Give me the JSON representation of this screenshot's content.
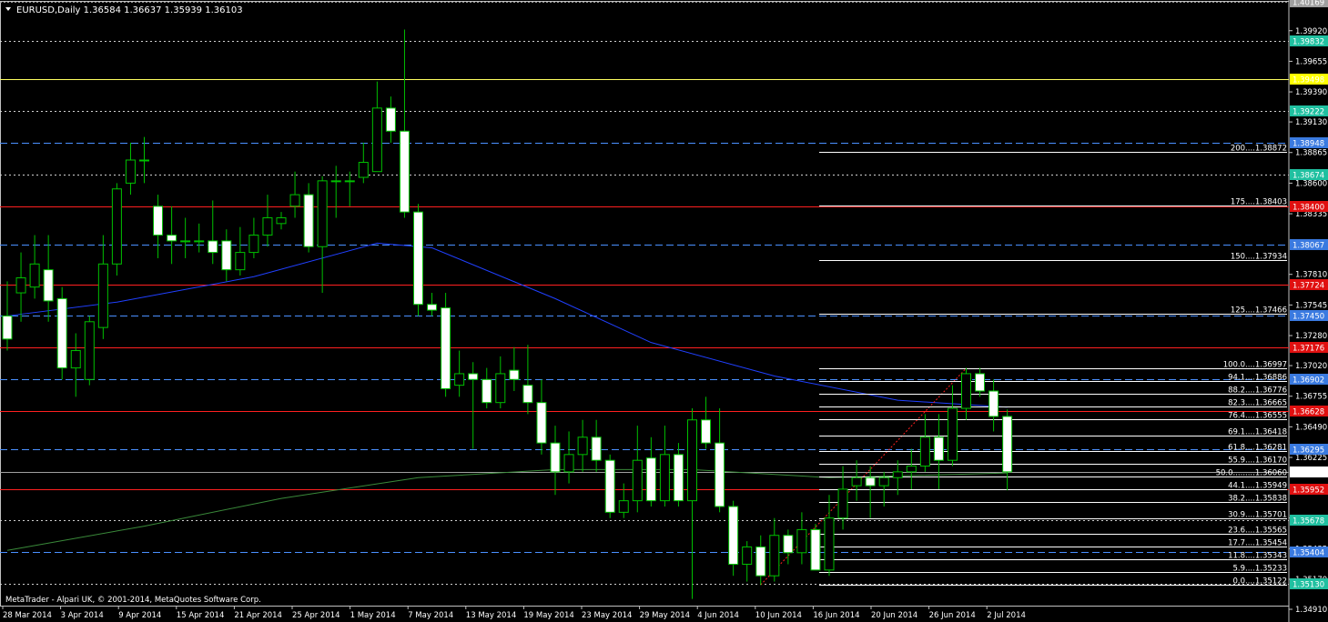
{
  "window": {
    "symbol_line": "EURUSD,Daily  1.36584 1.36637 1.35939 1.36103",
    "copyright": "MetaTrader - Alpari UK, © 2001-2014, MetaQuotes Software Corp."
  },
  "colors": {
    "background": "#000000",
    "bull": "#00c000",
    "bear": "#ffffff",
    "ma_fast": "#2040ff",
    "ma_slow": "#3a8a3a",
    "support": "#ff2020",
    "blue_level": "#4a90ff",
    "fib_line": "#ffffff",
    "fib_diag": "#ff2020",
    "current_price": "#a0a0a0"
  },
  "chart_data": {
    "type": "candlestick",
    "instrument": "EURUSD",
    "timeframe": "Daily",
    "ylim": [
      1.3491,
      1.4017
    ],
    "y_ticks": [
      "1.39920",
      "1.39655",
      "1.39390",
      "1.39130",
      "1.38865",
      "1.38600",
      "1.38335",
      "1.37810",
      "1.37545",
      "1.37280",
      "1.37020",
      "1.36755",
      "1.36490",
      "1.36225",
      "1.35700",
      "1.35435",
      "1.35170",
      "1.34910"
    ],
    "x_labels": [
      "28 Mar 2014",
      "3 Apr 2014",
      "9 Apr 2014",
      "15 Apr 2014",
      "21 Apr 2014",
      "25 Apr 2014",
      "1 May 2014",
      "7 May 2014",
      "13 May 2014",
      "19 May 2014",
      "23 May 2014",
      "29 May 2014",
      "4 Jun 2014",
      "10 Jun 2014",
      "16 Jun 2014",
      "20 Jun 2014",
      "26 Jun 2014",
      "2 Jul 2014"
    ],
    "price_labels": [
      {
        "text": "1.40169",
        "value": 1.40169,
        "kind": "grey"
      },
      {
        "text": "1.39832",
        "value": 1.39832,
        "kind": "teal"
      },
      {
        "text": "1.39498",
        "value": 1.39498,
        "kind": "yellow"
      },
      {
        "text": "1.39222",
        "value": 1.39222,
        "kind": "teal"
      },
      {
        "text": "1.38948",
        "value": 1.38948,
        "kind": "blue"
      },
      {
        "text": "1.38674",
        "value": 1.38674,
        "kind": "teal"
      },
      {
        "text": "1.38400",
        "value": 1.384,
        "kind": "red"
      },
      {
        "text": "1.38067",
        "value": 1.38067,
        "kind": "blue"
      },
      {
        "text": "1.37724",
        "value": 1.37724,
        "kind": "red"
      },
      {
        "text": "1.37450",
        "value": 1.3745,
        "kind": "blue"
      },
      {
        "text": "1.37176",
        "value": 1.37176,
        "kind": "red"
      },
      {
        "text": "1.36902",
        "value": 1.36902,
        "kind": "blue"
      },
      {
        "text": "1.36628",
        "value": 1.36628,
        "kind": "red"
      },
      {
        "text": "1.36295",
        "value": 1.36295,
        "kind": "blue"
      },
      {
        "text": "1.36103",
        "value": 1.36103,
        "kind": "current"
      },
      {
        "text": "1.35952",
        "value": 1.35952,
        "kind": "red"
      },
      {
        "text": "1.35678",
        "value": 1.35678,
        "kind": "teal"
      },
      {
        "text": "1.35404",
        "value": 1.35404,
        "kind": "blue"
      },
      {
        "text": "1.35130",
        "value": 1.3513,
        "kind": "teal"
      }
    ],
    "horizontal_levels": [
      {
        "value": 1.40169,
        "style": "dot-grey"
      },
      {
        "value": 1.39832,
        "style": "dot-white"
      },
      {
        "value": 1.39498,
        "style": "solid-yellow"
      },
      {
        "value": 1.39222,
        "style": "dot-white"
      },
      {
        "value": 1.38948,
        "style": "dash-blue"
      },
      {
        "value": 1.38674,
        "style": "dot-white"
      },
      {
        "value": 1.384,
        "style": "solid-red"
      },
      {
        "value": 1.38067,
        "style": "dash-blue"
      },
      {
        "value": 1.37724,
        "style": "solid-red"
      },
      {
        "value": 1.3745,
        "style": "dash-blue"
      },
      {
        "value": 1.37176,
        "style": "solid-red"
      },
      {
        "value": 1.36902,
        "style": "dash-blue"
      },
      {
        "value": 1.36628,
        "style": "solid-red"
      },
      {
        "value": 1.36295,
        "style": "dash-blue"
      },
      {
        "value": 1.36103,
        "style": "solid-grey"
      },
      {
        "value": 1.35952,
        "style": "solid-red"
      },
      {
        "value": 1.35678,
        "style": "dot-white"
      },
      {
        "value": 1.35404,
        "style": "dash-blue"
      },
      {
        "value": 1.3513,
        "style": "dot-white"
      }
    ],
    "fib_levels": [
      {
        "label": "200....1.38872",
        "value": 1.38872
      },
      {
        "label": "175....1.38403",
        "value": 1.38403
      },
      {
        "label": "150....1.37934",
        "value": 1.37934
      },
      {
        "label": "125....1.37466",
        "value": 1.37466
      },
      {
        "label": "100.0....1.36997",
        "value": 1.36997
      },
      {
        "label": "94.1....1.36886",
        "value": 1.36886
      },
      {
        "label": "88.2....1.36776",
        "value": 1.36776
      },
      {
        "label": "82.3....1.36665",
        "value": 1.36665
      },
      {
        "label": "76.4....1.36555",
        "value": 1.36555
      },
      {
        "label": "69.1....1.36418",
        "value": 1.36418
      },
      {
        "label": "61.8....1.36281",
        "value": 1.36281
      },
      {
        "label": "55.9....1.36170",
        "value": 1.3617
      },
      {
        "label": "50.0.........1.36060",
        "value": 1.3606
      },
      {
        "label": "44.1....1.35949",
        "value": 1.35949
      },
      {
        "label": "38.2....1.35838",
        "value": 1.35838
      },
      {
        "label": "30.9....1.35701",
        "value": 1.35701
      },
      {
        "label": "23.6....1.35565",
        "value": 1.35565
      },
      {
        "label": "17.7....1.35454",
        "value": 1.35454
      },
      {
        "label": "11.8....1.35343",
        "value": 1.35343
      },
      {
        "label": "5.9....1.35233",
        "value": 1.35233
      },
      {
        "label": "0.0....1.35122",
        "value": 1.35122
      }
    ],
    "candles": [
      [
        1.3745,
        1.3725,
        1.3775,
        1.3715
      ],
      [
        1.3765,
        1.3778,
        1.38,
        1.374
      ],
      [
        1.377,
        1.379,
        1.3815,
        1.376
      ],
      [
        1.3785,
        1.3758,
        1.3815,
        1.374
      ],
      [
        1.376,
        1.37,
        1.377,
        1.369
      ],
      [
        1.37,
        1.3715,
        1.373,
        1.3675
      ],
      [
        1.369,
        1.374,
        1.3745,
        1.3685
      ],
      [
        1.3735,
        1.379,
        1.3815,
        1.3725
      ],
      [
        1.379,
        1.3855,
        1.386,
        1.378
      ],
      [
        1.386,
        1.388,
        1.3895,
        1.385
      ],
      [
        1.388,
        1.388,
        1.39,
        1.386
      ],
      [
        1.384,
        1.3815,
        1.385,
        1.3795
      ],
      [
        1.3815,
        1.381,
        1.384,
        1.379
      ],
      [
        1.381,
        1.381,
        1.383,
        1.3795
      ],
      [
        1.381,
        1.381,
        1.3825,
        1.38
      ],
      [
        1.381,
        1.38,
        1.3845,
        1.379
      ],
      [
        1.381,
        1.3785,
        1.382,
        1.3775
      ],
      [
        1.3785,
        1.38,
        1.3822,
        1.378
      ],
      [
        1.38,
        1.3815,
        1.383,
        1.3795
      ],
      [
        1.3815,
        1.383,
        1.385,
        1.3805
      ],
      [
        1.3825,
        1.383,
        1.3835,
        1.382
      ],
      [
        1.384,
        1.385,
        1.387,
        1.383
      ],
      [
        1.385,
        1.3805,
        1.386,
        1.38
      ],
      [
        1.3805,
        1.3862,
        1.3866,
        1.3765
      ],
      [
        1.3862,
        1.3862,
        1.3875,
        1.383
      ],
      [
        1.3862,
        1.3862,
        1.387,
        1.384
      ],
      [
        1.3865,
        1.3878,
        1.3895,
        1.386
      ],
      [
        1.387,
        1.3925,
        1.3948,
        1.387
      ],
      [
        1.3925,
        1.3905,
        1.3935,
        1.3895
      ],
      [
        1.3905,
        1.3835,
        1.3993,
        1.383
      ],
      [
        1.3835,
        1.3755,
        1.3842,
        1.3745
      ],
      [
        1.3755,
        1.375,
        1.3765,
        1.3745
      ],
      [
        1.3752,
        1.3682,
        1.3765,
        1.3675
      ],
      [
        1.3685,
        1.3695,
        1.3715,
        1.3675
      ],
      [
        1.3695,
        1.369,
        1.3705,
        1.363
      ],
      [
        1.369,
        1.367,
        1.37,
        1.3665
      ],
      [
        1.367,
        1.3695,
        1.371,
        1.3665
      ],
      [
        1.3698,
        1.369,
        1.3718,
        1.368
      ],
      [
        1.3685,
        1.367,
        1.372,
        1.366
      ],
      [
        1.367,
        1.3635,
        1.369,
        1.3625
      ],
      [
        1.3635,
        1.361,
        1.365,
        1.359
      ],
      [
        1.361,
        1.3625,
        1.3645,
        1.36
      ],
      [
        1.3625,
        1.364,
        1.3655,
        1.361
      ],
      [
        1.364,
        1.362,
        1.3655,
        1.361
      ],
      [
        1.362,
        1.3575,
        1.3625,
        1.357
      ],
      [
        1.3575,
        1.3585,
        1.36,
        1.357
      ],
      [
        1.3585,
        1.362,
        1.365,
        1.3575
      ],
      [
        1.3622,
        1.3585,
        1.364,
        1.358
      ],
      [
        1.3585,
        1.3625,
        1.365,
        1.358
      ],
      [
        1.3625,
        1.3585,
        1.3635,
        1.358
      ],
      [
        1.3585,
        1.3655,
        1.3665,
        1.35
      ],
      [
        1.3655,
        1.3635,
        1.3675,
        1.363
      ],
      [
        1.3635,
        1.358,
        1.3665,
        1.3575
      ],
      [
        1.358,
        1.353,
        1.3585,
        1.352
      ],
      [
        1.353,
        1.3545,
        1.355,
        1.3515
      ],
      [
        1.3545,
        1.352,
        1.3555,
        1.3512
      ],
      [
        1.352,
        1.3555,
        1.357,
        1.3515
      ],
      [
        1.3555,
        1.354,
        1.356,
        1.353
      ],
      [
        1.354,
        1.356,
        1.3575,
        1.353
      ],
      [
        1.356,
        1.3525,
        1.3565,
        1.3525
      ],
      [
        1.3525,
        1.357,
        1.359,
        1.352
      ],
      [
        1.357,
        1.3595,
        1.3615,
        1.356
      ],
      [
        1.3598,
        1.3605,
        1.362,
        1.3585
      ],
      [
        1.3605,
        1.3598,
        1.3615,
        1.357
      ],
      [
        1.3598,
        1.3605,
        1.361,
        1.358
      ],
      [
        1.3605,
        1.361,
        1.362,
        1.359
      ],
      [
        1.361,
        1.3615,
        1.363,
        1.3595
      ],
      [
        1.3615,
        1.364,
        1.366,
        1.361
      ],
      [
        1.364,
        1.362,
        1.366,
        1.3595
      ],
      [
        1.362,
        1.3665,
        1.3685,
        1.3615
      ],
      [
        1.3665,
        1.3695,
        1.37,
        1.3655
      ],
      [
        1.3695,
        1.368,
        1.37,
        1.3675
      ],
      [
        1.368,
        1.3658,
        1.369,
        1.3645
      ],
      [
        1.3658,
        1.361,
        1.3664,
        1.3594
      ]
    ],
    "ma_fast": [
      [
        0,
        1.3745
      ],
      [
        8,
        1.3757
      ],
      [
        18,
        1.3779
      ],
      [
        27,
        1.3808
      ],
      [
        31,
        1.3804
      ],
      [
        40,
        1.376
      ],
      [
        47,
        1.3722
      ],
      [
        56,
        1.3693
      ],
      [
        65,
        1.3672
      ],
      [
        73,
        1.3666
      ]
    ],
    "ma_slow": [
      [
        0,
        1.3542
      ],
      [
        10,
        1.3563
      ],
      [
        20,
        1.3587
      ],
      [
        30,
        1.3605
      ],
      [
        40,
        1.3612
      ],
      [
        50,
        1.3612
      ],
      [
        60,
        1.3605
      ],
      [
        70,
        1.3608
      ],
      [
        73,
        1.3609
      ]
    ]
  }
}
